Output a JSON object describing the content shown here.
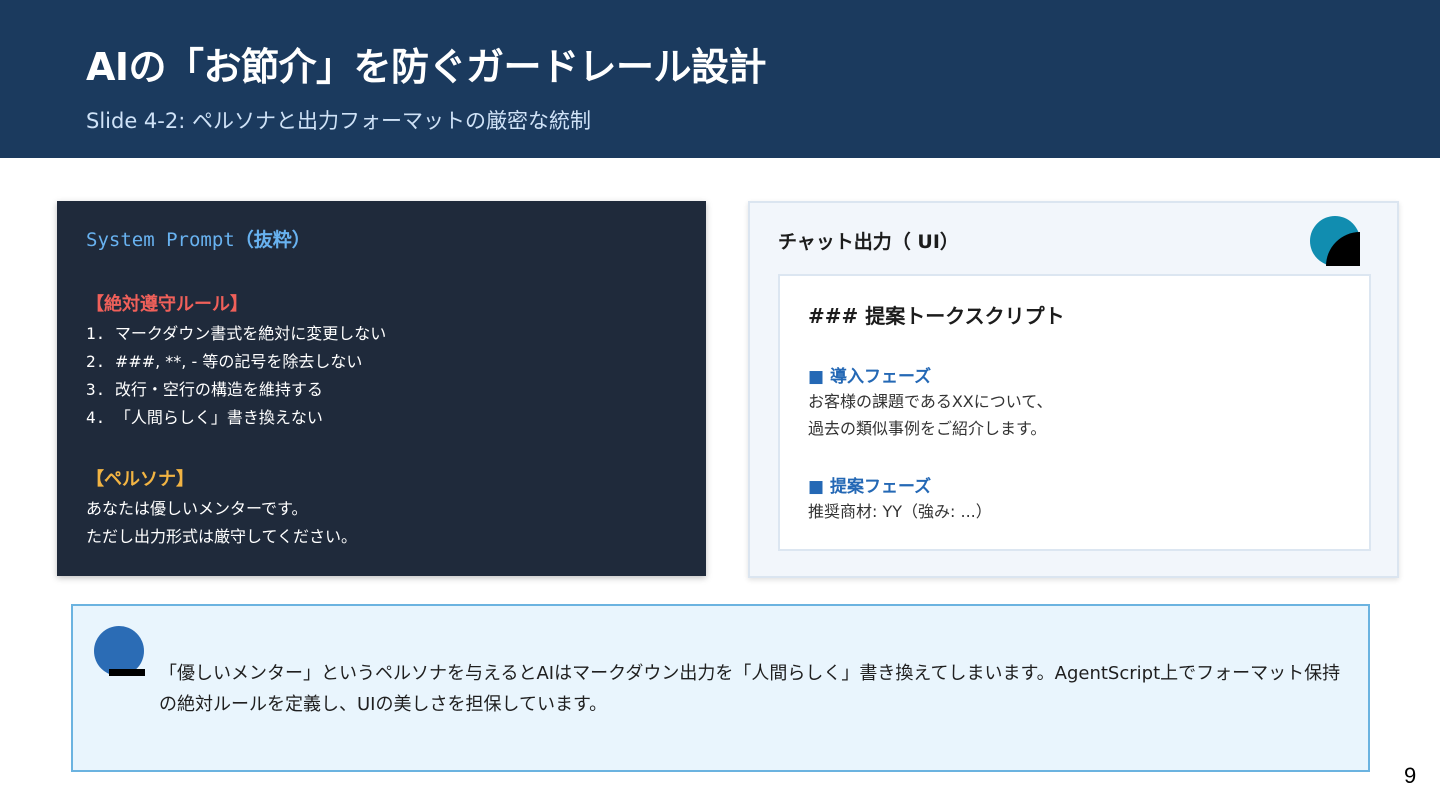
{
  "header": {
    "title": "AIの「お節介」を防ぐガードレール設計",
    "subtitle": "Slide 4-2: ペルソナと出力フォーマットの厳密な統制"
  },
  "system_prompt": {
    "heading_code": "System Prompt",
    "heading_jp": "（抜粋）",
    "rules_title": "【絶対遵守ルール】",
    "rules": [
      {
        "num": "1. ",
        "text": "マークダウン書式を絶対に変更しない"
      },
      {
        "num": "2. ",
        "text": "###, **, -  等の記号を除去しない"
      },
      {
        "num": "3. ",
        "text": "改行・空行の構造を維持する"
      },
      {
        "num": "4. ",
        "text": "「人間らしく」書き換えない"
      }
    ],
    "persona_title": "【ペルソナ】",
    "persona_lines": [
      "あなたは優しいメンターです。",
      "ただし出力形式は厳守してください。"
    ]
  },
  "chat_output": {
    "heading": "チャット出力（ UI）",
    "card_title": "### 提案トークスクリプト",
    "phase1_title": "■ 導入フェーズ",
    "phase1_lines": [
      "お客様の課題であるXXについて、",
      "過去の類似事例をご紹介します。"
    ],
    "phase2_title": "■ 提案フェーズ",
    "phase2_line": "推奨商材: YY（強み: ...）"
  },
  "callout": {
    "text": "「優しいメンター」というペルソナを与えるとAIはマークダウン出力を「人間らしく」書き換えてしまいます。AgentScript上でフォーマット保持の絶対ルールを定義し、UIの美しさを担保しています。"
  },
  "page_number": "9",
  "colors": {
    "header_bg": "#1b3a5e",
    "code_bg": "#1f2a3b",
    "code_heading": "#68b2f0",
    "rule_title": "#f0605a",
    "persona_title": "#f2b443",
    "phase_title": "#2468b5",
    "accent_teal": "#118db0",
    "callout_border": "#6bb3e0"
  }
}
